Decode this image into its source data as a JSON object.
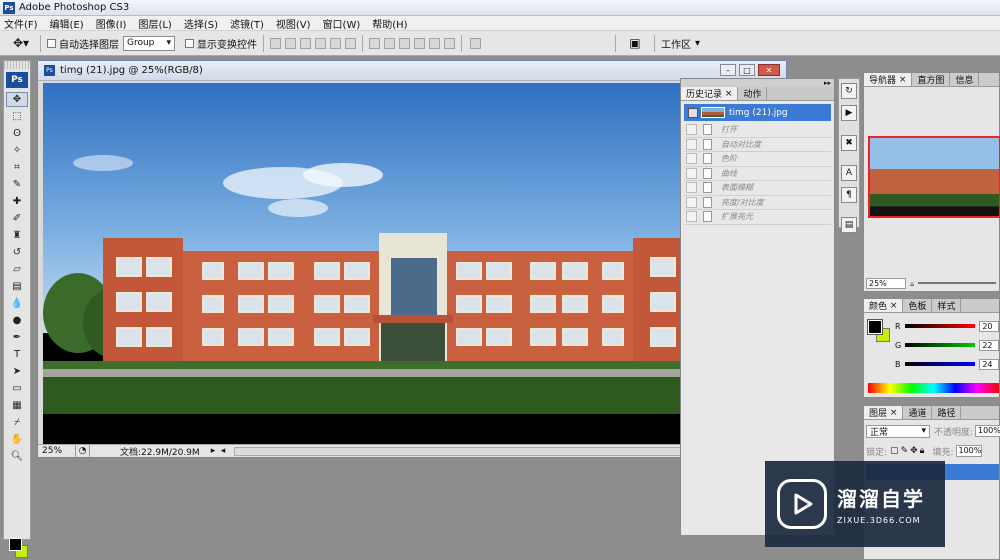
{
  "window": {
    "title": "Adobe Photoshop CS3",
    "app_icon_text": "Ps"
  },
  "menu": {
    "items": [
      "文件(F)",
      "编辑(E)",
      "图像(I)",
      "图层(L)",
      "选择(S)",
      "滤镜(T)",
      "视图(V)",
      "窗口(W)",
      "帮助(H)"
    ]
  },
  "options": {
    "auto_select_label": "自动选择图层",
    "auto_select_value": "Group",
    "show_transform_label": "显示变换控件",
    "workspace_label": "工作区"
  },
  "toolbox": {
    "logo": "Ps",
    "tools": [
      "move",
      "marquee",
      "lasso",
      "magic-wand",
      "crop",
      "slice",
      "healing",
      "brush",
      "stamp",
      "history-brush",
      "eraser",
      "gradient",
      "blur",
      "dodge",
      "pen",
      "type",
      "path-select",
      "shape",
      "notes",
      "eyedropper",
      "hand",
      "zoom"
    ],
    "foreground_color": "#000000",
    "background_color": "#c3f004"
  },
  "document": {
    "title": "timg (21).jpg @ 25%(RGB/8)",
    "zoom": "25%",
    "doc_info": "文档:22.9M/20.9M"
  },
  "history_panel": {
    "tabs": [
      "历史记录",
      "动作"
    ],
    "active_tab": "历史记录",
    "snapshot_label": "timg (21).jpg",
    "steps": [
      "打开",
      "自动对比度",
      "色阶",
      "曲线",
      "表面模糊",
      "亮度/对比度",
      "扩展亮光"
    ]
  },
  "navigator_panel": {
    "tabs": [
      "导航器",
      "直方图",
      "信息"
    ],
    "active_tab": "导航器",
    "zoom": "25%"
  },
  "color_panel": {
    "tabs": [
      "颜色",
      "色板",
      "样式"
    ],
    "active_tab": "颜色",
    "channels": [
      {
        "label": "R",
        "value": "20"
      },
      {
        "label": "G",
        "value": "22"
      },
      {
        "label": "B",
        "value": "24"
      }
    ]
  },
  "layers_panel": {
    "tabs": [
      "图层",
      "通道",
      "路径"
    ],
    "active_tab": "图层",
    "blend_mode": "正常",
    "opacity_label": "不透明度:",
    "opacity_value": "100%",
    "lock_label": "锁定:",
    "fill_label": "填充:",
    "fill_value": "100%"
  },
  "watermark": {
    "brand": "溜溜自学",
    "url": "ZIXUE.3D66.COM"
  }
}
